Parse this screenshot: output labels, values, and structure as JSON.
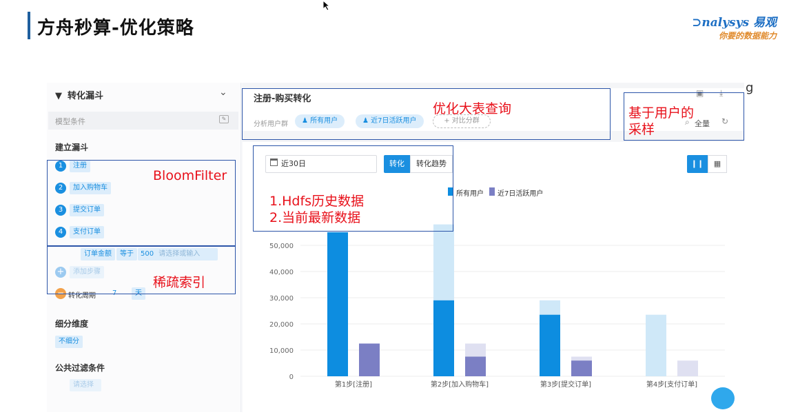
{
  "slide": {
    "title": "方舟秒算-优化策略",
    "logo_main": "nalysys 易观",
    "logo_sub": "你要的数据能力"
  },
  "sidebar": {
    "header": "转化漏斗",
    "model_condition": "模型条件",
    "build_funnel": "建立漏斗",
    "steps": [
      {
        "num": "1",
        "label": "注册"
      },
      {
        "num": "2",
        "label": "加入购物车"
      },
      {
        "num": "3",
        "label": "提交订单"
      },
      {
        "num": "4",
        "label": "支付订单"
      }
    ],
    "filter": {
      "field": "订单金额",
      "op": "等于",
      "value": "500",
      "placeholder": "请选择或输入"
    },
    "add_step": "添加步骤",
    "period_label": "转化周期",
    "period_value": "7",
    "period_unit": "天",
    "breakdown_label": "细分维度",
    "breakdown_value": "不细分",
    "public_filter_label": "公共过滤条件",
    "public_filter_placeholder": "请选择"
  },
  "main": {
    "title": "注册-购买转化",
    "group_label": "分析用户群",
    "groups": [
      "所有用户",
      "近7日活跃用户"
    ],
    "compare": "+ 对比分群",
    "all_label": "全量",
    "date_range": "近30日",
    "tabs": [
      "转化",
      "转化趋势"
    ]
  },
  "annotations": {
    "query": "优化大表查询",
    "sampling_line1": "基于用户的",
    "sampling_line2": "采样",
    "bloom": "BloomFilter",
    "hdfs_line1": "1.Hdfs历史数据",
    "hdfs_line2": "2.当前最新数据",
    "sparse": "稀疏索引"
  },
  "stray_text": "g",
  "colors": {
    "primary": "#1a8fe0",
    "series_all": "#0d8de0",
    "series_all_light": "#cfe8f8",
    "series_active": "#7b7fc4",
    "series_active_light": "#dfe0f1",
    "annotation_red": "#e8101a",
    "annotation_box": "#2b54a8"
  },
  "chart_data": {
    "type": "bar",
    "categories": [
      "第1步[注册]",
      "第2步[加入购物车]",
      "第3步[提交订单]",
      "第4步[支付订单]"
    ],
    "series": [
      {
        "name": "所有用户",
        "values": [
          55000,
          29000,
          23500,
          0
        ],
        "lost": [
          0,
          29000,
          5500,
          23500
        ]
      },
      {
        "name": "近7日活跃用户",
        "values": [
          12500,
          7500,
          6000,
          0
        ],
        "lost": [
          0,
          5000,
          1500,
          6000
        ]
      }
    ],
    "yticks": [
      0,
      10000,
      20000,
      30000,
      40000,
      50000
    ],
    "ytick_labels": [
      "0",
      "10,000",
      "20,000",
      "30,000",
      "40,000",
      "50,000"
    ],
    "ylim": [
      0,
      60000
    ],
    "legend_position": "top-center",
    "grid": true
  }
}
